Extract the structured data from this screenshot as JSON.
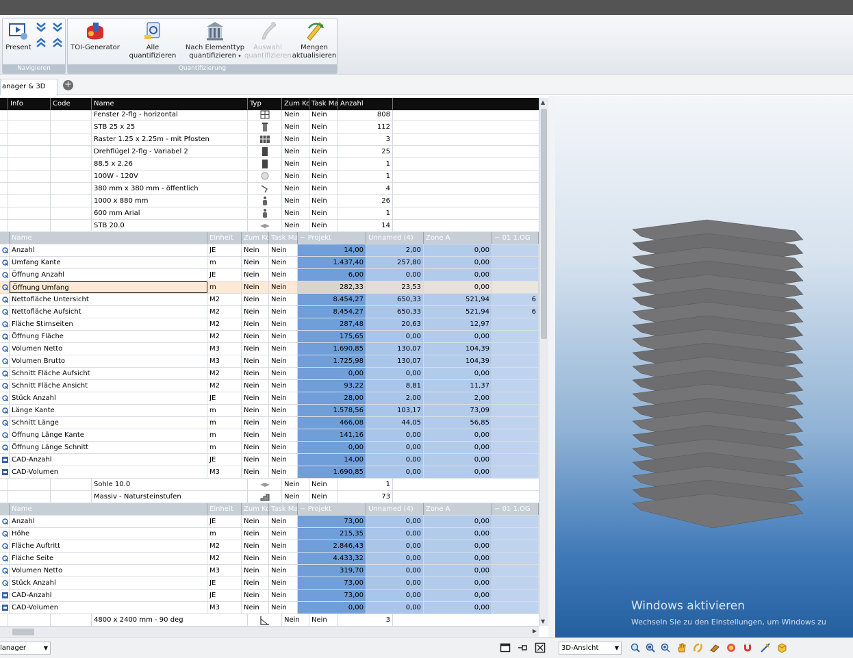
{
  "ribbon": {
    "navigieren": {
      "label": "Navigieren",
      "present_label": "Present"
    },
    "quantifizierung": {
      "label": "Quantifizierung",
      "toi_label": "TOI-Generator",
      "alle_label": "Alle quantifizieren",
      "nach_line1": "Nach Elementtyp",
      "nach_line2": "quantifizieren",
      "auswahl_line1": "Auswahl",
      "auswahl_line2": "quantifizieren",
      "mengen_line1": "Mengen",
      "mengen_line2": "aktualisieren"
    }
  },
  "tabs": {
    "active_label": "anager & 3D",
    "add_symbol": "+"
  },
  "grid": {
    "header": {
      "info": "Info",
      "code": "Code",
      "name": "Name",
      "typ": "Typ",
      "zum": "Zum Ko",
      "task": "Task Ma",
      "anzahl": "Anzahl"
    },
    "elements_top": [
      {
        "name": "Fenster 2-flg - horizontal",
        "zum": "Nein",
        "task": "Nein",
        "anzahl": "808",
        "icon": "window-icon"
      },
      {
        "name": "STB 25 x 25",
        "zum": "Nein",
        "task": "Nein",
        "anzahl": "112",
        "icon": "column-icon"
      },
      {
        "name": "Raster 1.25 x 2.25m - mit Pfosten",
        "zum": "Nein",
        "task": "Nein",
        "anzahl": "3",
        "icon": "grid-wall-icon"
      },
      {
        "name": "Drehflügel 2-flg - Variabel 2",
        "zum": "Nein",
        "task": "Nein",
        "anzahl": "25",
        "icon": "door-icon"
      },
      {
        "name": "88.5 x 2.26",
        "zum": "Nein",
        "task": "Nein",
        "anzahl": "1",
        "icon": "door-icon"
      },
      {
        "name": "100W - 120V",
        "zum": "Nein",
        "task": "Nein",
        "anzahl": "1",
        "icon": "lamp-icon"
      },
      {
        "name": "380 mm x 380 mm - öffentlich",
        "zum": "Nein",
        "task": "Nein",
        "anzahl": "4",
        "icon": "fixture-icon"
      },
      {
        "name": "1000 x 880 mm",
        "zum": "Nein",
        "task": "Nein",
        "anzahl": "26",
        "icon": "person-icon"
      },
      {
        "name": "600 mm Arial",
        "zum": "Nein",
        "task": "Nein",
        "anzahl": "1",
        "icon": "person-icon"
      },
      {
        "name": "STB 20.0",
        "zum": "Nein",
        "task": "Nein",
        "anzahl": "14",
        "icon": "slab-icon"
      }
    ],
    "subheader": {
      "name": "Name",
      "einheit": "Einheit",
      "zum": "Zum Ko",
      "task": "Task Ma",
      "projekt": "Projekt",
      "unnamed": "Unnamed (4)",
      "zone": "Zone A",
      "og": "01 1.OG"
    },
    "quantities_1": [
      {
        "name": "Anzahl",
        "einheit": "JE",
        "zum": "Nein",
        "task": "Nein",
        "projekt": "14,00",
        "unnamed": "2,00",
        "zone": "0,00",
        "og": ""
      },
      {
        "name": "Umfang Kante",
        "einheit": "m",
        "zum": "Nein",
        "task": "Nein",
        "projekt": "1.437,40",
        "unnamed": "257,80",
        "zone": "0,00",
        "og": ""
      },
      {
        "name": "Öffnung Anzahl",
        "einheit": "JE",
        "zum": "Nein",
        "task": "Nein",
        "projekt": "6,00",
        "unnamed": "0,00",
        "zone": "0,00",
        "og": ""
      },
      {
        "name": "Öffnung Umfang",
        "einheit": "m",
        "zum": "Nein",
        "task": "Nein",
        "projekt": "282,33",
        "unnamed": "23,53",
        "zone": "0,00",
        "og": ""
      },
      {
        "name": "Nettofläche Untersicht",
        "einheit": "M2",
        "zum": "Nein",
        "task": "Nein",
        "projekt": "8.454,27",
        "unnamed": "650,33",
        "zone": "521,94",
        "og": "6"
      },
      {
        "name": "Nettofläche Aufsicht",
        "einheit": "M2",
        "zum": "Nein",
        "task": "Nein",
        "projekt": "8.454,27",
        "unnamed": "650,33",
        "zone": "521,94",
        "og": "6"
      },
      {
        "name": "Fläche Stirnseiten",
        "einheit": "M2",
        "zum": "Nein",
        "task": "Nein",
        "projekt": "287,48",
        "unnamed": "20,63",
        "zone": "12,97",
        "og": ""
      },
      {
        "name": "Öffnung Fläche",
        "einheit": "M2",
        "zum": "Nein",
        "task": "Nein",
        "projekt": "175,65",
        "unnamed": "0,00",
        "zone": "0,00",
        "og": ""
      },
      {
        "name": "Volumen Netto",
        "einheit": "M3",
        "zum": "Nein",
        "task": "Nein",
        "projekt": "1.690,85",
        "unnamed": "130,07",
        "zone": "104,39",
        "og": ""
      },
      {
        "name": "Volumen Brutto",
        "einheit": "M3",
        "zum": "Nein",
        "task": "Nein",
        "projekt": "1.725,98",
        "unnamed": "130,07",
        "zone": "104,39",
        "og": ""
      },
      {
        "name": "Schnitt Fläche Aufsicht",
        "einheit": "M2",
        "zum": "Nein",
        "task": "Nein",
        "projekt": "0,00",
        "unnamed": "0,00",
        "zone": "0,00",
        "og": ""
      },
      {
        "name": "Schnitt Fläche Ansicht",
        "einheit": "M2",
        "zum": "Nein",
        "task": "Nein",
        "projekt": "93,22",
        "unnamed": "8,81",
        "zone": "11,37",
        "og": ""
      },
      {
        "name": "Stück Anzahl",
        "einheit": "JE",
        "zum": "Nein",
        "task": "Nein",
        "projekt": "28,00",
        "unnamed": "2,00",
        "zone": "2,00",
        "og": ""
      },
      {
        "name": "Länge Kante",
        "einheit": "m",
        "zum": "Nein",
        "task": "Nein",
        "projekt": "1.578,56",
        "unnamed": "103,17",
        "zone": "73,09",
        "og": ""
      },
      {
        "name": "Schnitt Länge",
        "einheit": "m",
        "zum": "Nein",
        "task": "Nein",
        "projekt": "466,08",
        "unnamed": "44,05",
        "zone": "56,85",
        "og": ""
      },
      {
        "name": "Öffnung Länge Kante",
        "einheit": "m",
        "zum": "Nein",
        "task": "Nein",
        "projekt": "141,16",
        "unnamed": "0,00",
        "zone": "0,00",
        "og": ""
      },
      {
        "name": "Öffnung Länge Schnitt",
        "einheit": "m",
        "zum": "Nein",
        "task": "Nein",
        "projekt": "0,00",
        "unnamed": "0,00",
        "zone": "0,00",
        "og": ""
      },
      {
        "name": "CAD-Anzahl",
        "einheit": "JE",
        "zum": "Nein",
        "task": "Nein",
        "projekt": "14,00",
        "unnamed": "0,00",
        "zone": "0,00",
        "og": ""
      },
      {
        "name": "CAD-Volumen",
        "einheit": "M3",
        "zum": "Nein",
        "task": "Nein",
        "projekt": "1.690,85",
        "unnamed": "0,00",
        "zone": "0,00",
        "og": ""
      }
    ],
    "elements_mid": [
      {
        "name": "Sohle 10.0",
        "zum": "Nein",
        "task": "Nein",
        "anzahl": "1",
        "icon": "slab-icon"
      },
      {
        "name": "Massiv - Natursteinstufen",
        "zum": "Nein",
        "task": "Nein",
        "anzahl": "73",
        "icon": "stairs-icon"
      }
    ],
    "quantities_2": [
      {
        "name": "Anzahl",
        "einheit": "JE",
        "zum": "Nein",
        "task": "Nein",
        "projekt": "73,00",
        "unnamed": "0,00",
        "zone": "0,00",
        "og": ""
      },
      {
        "name": "Höhe",
        "einheit": "m",
        "zum": "Nein",
        "task": "Nein",
        "projekt": "215,35",
        "unnamed": "0,00",
        "zone": "0,00",
        "og": ""
      },
      {
        "name": "Fläche Auftritt",
        "einheit": "M2",
        "zum": "Nein",
        "task": "Nein",
        "projekt": "2.846,43",
        "unnamed": "0,00",
        "zone": "0,00",
        "og": ""
      },
      {
        "name": "Fläche Seite",
        "einheit": "M2",
        "zum": "Nein",
        "task": "Nein",
        "projekt": "4.433,32",
        "unnamed": "0,00",
        "zone": "0,00",
        "og": ""
      },
      {
        "name": "Volumen Netto",
        "einheit": "M3",
        "zum": "Nein",
        "task": "Nein",
        "projekt": "319,70",
        "unnamed": "0,00",
        "zone": "0,00",
        "og": ""
      },
      {
        "name": "Stück Anzahl",
        "einheit": "JE",
        "zum": "Nein",
        "task": "Nein",
        "projekt": "73,00",
        "unnamed": "0,00",
        "zone": "0,00",
        "og": ""
      },
      {
        "name": "CAD-Anzahl",
        "einheit": "JE",
        "zum": "Nein",
        "task": "Nein",
        "projekt": "73,00",
        "unnamed": "0,00",
        "zone": "0,00",
        "og": ""
      },
      {
        "name": "CAD-Volumen",
        "einheit": "M3",
        "zum": "Nein",
        "task": "Nein",
        "projekt": "0,00",
        "unnamed": "0,00",
        "zone": "0,00",
        "og": ""
      }
    ],
    "elements_bottom": [
      {
        "name": "4800 x 2400 mm - 90 deg",
        "zum": "Nein",
        "task": "Nein",
        "anzahl": "3",
        "icon": "ramp-icon"
      }
    ],
    "selected_quantity": "Öffnung Umfang"
  },
  "viewport": {
    "watermark_title": "Windows aktivieren",
    "watermark_text": "Wechseln Sie zu den Einstellungen, um Windows zu"
  },
  "bottombar": {
    "left_combo": "lanager",
    "view_combo": "3D-Ansicht"
  },
  "colors": {
    "projekt": "#6f9ed8",
    "unnamed": "#a9c5ea",
    "zone": "#b2cbeb",
    "og": "#bfd3ee",
    "selected": "#fde9d6",
    "header": "#0e0e0e"
  }
}
